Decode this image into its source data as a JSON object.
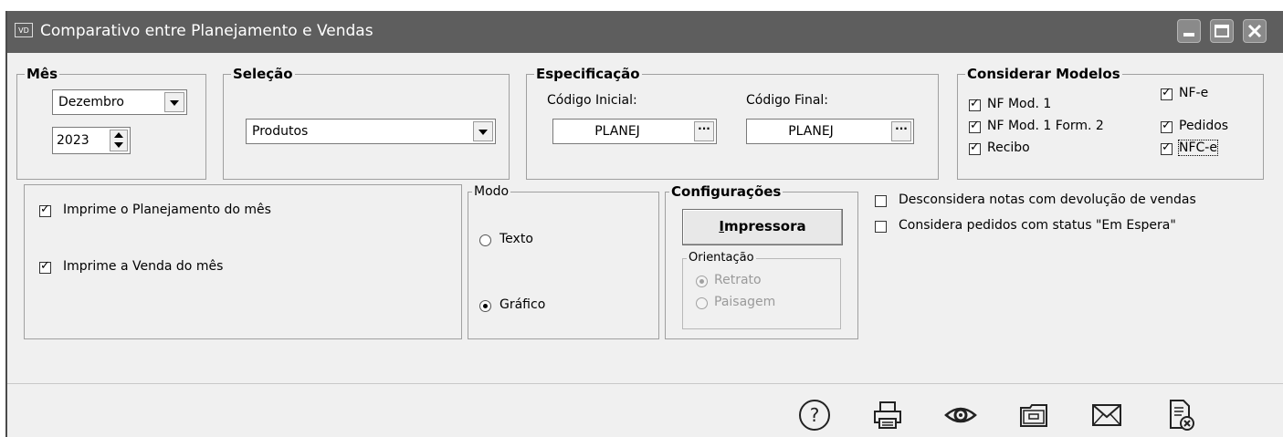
{
  "window": {
    "app_icon": "VD",
    "title": "Comparativo entre Planejamento e Vendas",
    "controls": [
      "minimize-icon",
      "maximize-icon",
      "close-icon"
    ]
  },
  "mes": {
    "label": "Mês",
    "month_value": "Dezembro",
    "year_value": "2023"
  },
  "selecao": {
    "label": "Seleção",
    "value": "Produtos"
  },
  "especificacao": {
    "label": "Especificação",
    "codigo_inicial_label": "Código Inicial:",
    "codigo_inicial_value": "PLANEJ",
    "codigo_final_label": "Código Final:",
    "codigo_final_value": "PLANEJ",
    "ellipsis": "···"
  },
  "considerar_modelos": {
    "label": "Considerar Modelos",
    "items": [
      {
        "label": "NF Mod. 1",
        "checked": true
      },
      {
        "label": "NF Mod. 1 Form. 2",
        "checked": true
      },
      {
        "label": "Recibo",
        "checked": true
      },
      {
        "label": "NF-e",
        "checked": true
      },
      {
        "label": "Pedidos",
        "checked": true
      },
      {
        "label": "NFC-e",
        "checked": true
      }
    ]
  },
  "imprime": {
    "planejamento_label": "Imprime o Planejamento do mês",
    "venda_label": "Imprime a Venda do mês"
  },
  "modo": {
    "label": "Modo",
    "texto_label": "Texto",
    "grafico_label": "Gráfico",
    "selected": "Gráfico"
  },
  "configuracoes": {
    "label": "Configurações",
    "impressora_button": "Impressora",
    "orientacao_label": "Orientação",
    "retrato_label": "Retrato",
    "paisagem_label": "Paisagem"
  },
  "opcoes": {
    "desconsidera_label": "Desconsidera notas com devolução de vendas",
    "considera_label": "Considera pedidos com status \"Em Espera\""
  },
  "footer": {
    "icons": [
      "help-icon",
      "printer-icon",
      "preview-eye-icon",
      "folder-icon",
      "email-icon",
      "close-report-icon"
    ]
  }
}
